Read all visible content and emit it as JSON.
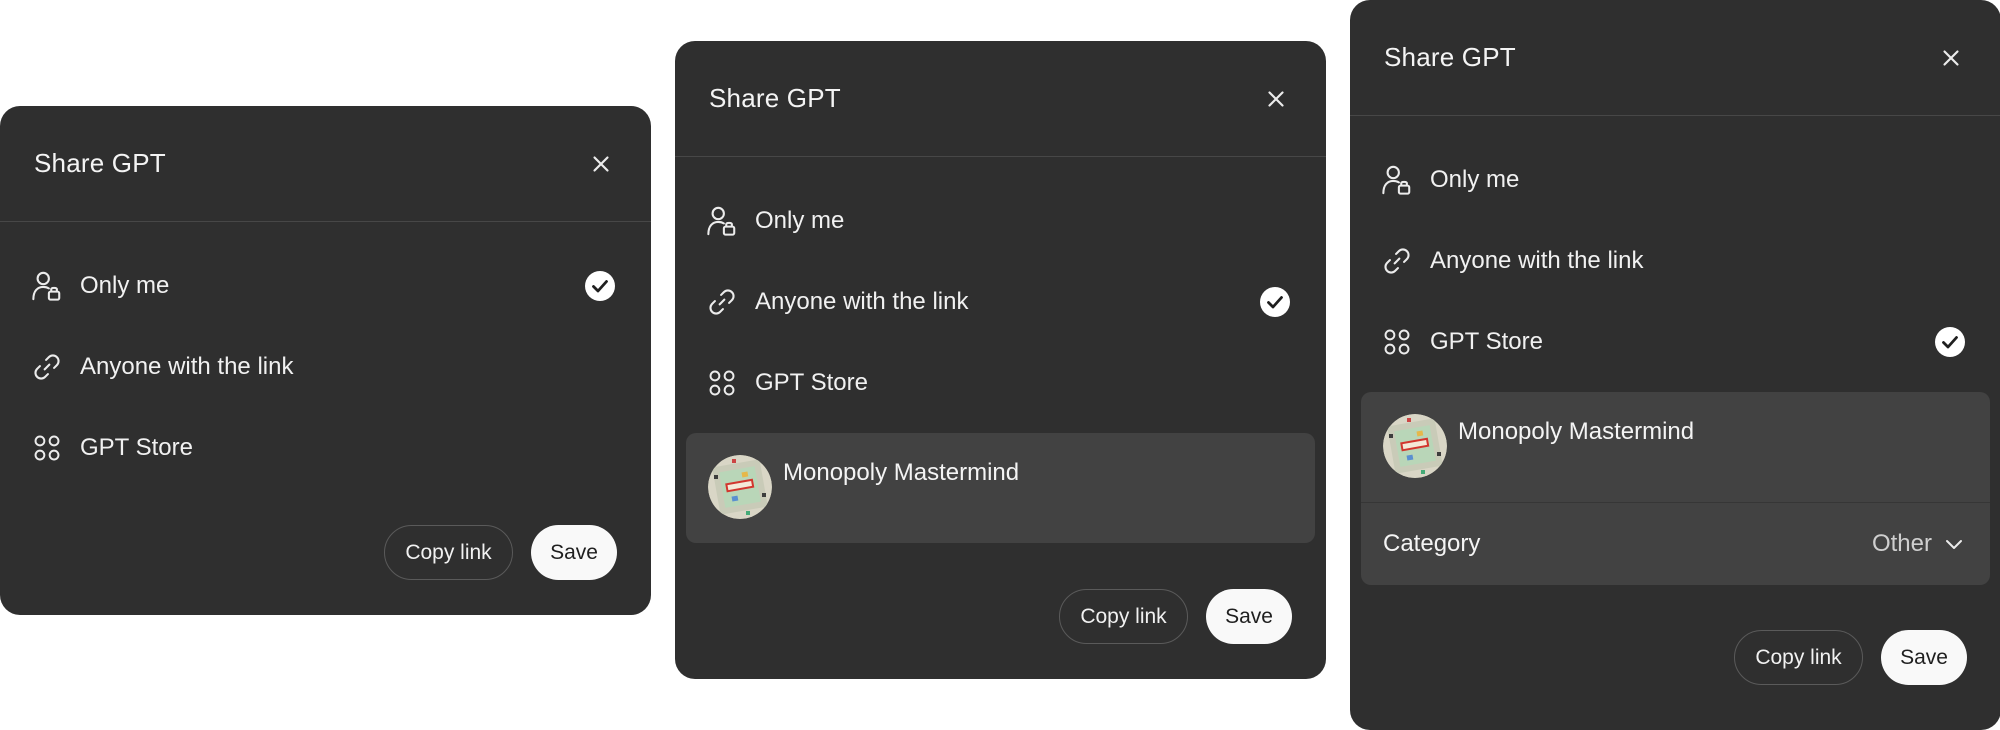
{
  "dialogs": [
    {
      "title": "Share GPT",
      "options": [
        {
          "label": "Only me",
          "icon": "person-lock-icon",
          "selected": true
        },
        {
          "label": "Anyone with the link",
          "icon": "link-icon",
          "selected": false
        },
        {
          "label": "GPT Store",
          "icon": "apps-grid-icon",
          "selected": false
        }
      ],
      "copy_link_label": "Copy link",
      "save_label": "Save"
    },
    {
      "title": "Share GPT",
      "options": [
        {
          "label": "Only me",
          "icon": "person-lock-icon",
          "selected": false
        },
        {
          "label": "Anyone with the link",
          "icon": "link-icon",
          "selected": true
        },
        {
          "label": "GPT Store",
          "icon": "apps-grid-icon",
          "selected": false
        }
      ],
      "gpt_name": "Monopoly Mastermind",
      "copy_link_label": "Copy link",
      "save_label": "Save"
    },
    {
      "title": "Share GPT",
      "options": [
        {
          "label": "Only me",
          "icon": "person-lock-icon",
          "selected": false
        },
        {
          "label": "Anyone with the link",
          "icon": "link-icon",
          "selected": false
        },
        {
          "label": "GPT Store",
          "icon": "apps-grid-icon",
          "selected": true
        }
      ],
      "gpt_name": "Monopoly Mastermind",
      "category_label": "Category",
      "category_value": "Other",
      "copy_link_label": "Copy link",
      "save_label": "Save"
    }
  ],
  "colors": {
    "dialog_bg": "#2f2f2f",
    "card_bg": "#424242",
    "divider": "#474747",
    "text": "#ececec",
    "primary_button_bg": "#f9f9f9"
  }
}
